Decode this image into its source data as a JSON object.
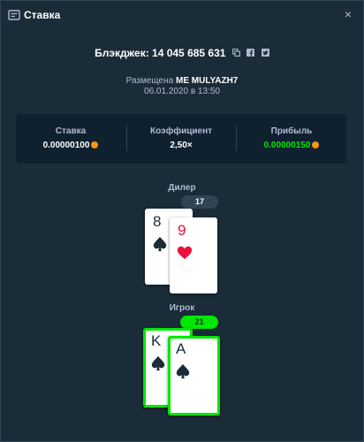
{
  "header": {
    "title": "Ставка",
    "close_glyph": "×"
  },
  "bet": {
    "title": "Блэкджек: 14 045 685 631",
    "placed_prefix": "Размещена",
    "user": "ME MULYAZH7",
    "date": "06.01.2020 в 13:50"
  },
  "stats": {
    "stake_label": "Ставка",
    "stake_value": "0.00000100",
    "multiplier_label": "Коэффициент",
    "multiplier_value": "2,50×",
    "profit_label": "Прибыль",
    "profit_value": "0.00000150"
  },
  "dealer": {
    "label": "Дилер",
    "score": "17",
    "cards": [
      {
        "rank": "8",
        "suit": "spade"
      },
      {
        "rank": "9",
        "suit": "heart"
      }
    ]
  },
  "player": {
    "label": "Игрок",
    "score": "21",
    "cards": [
      {
        "rank": "K",
        "suit": "spade"
      },
      {
        "rank": "A",
        "suit": "spade"
      }
    ]
  },
  "colors": {
    "background": "#1a2c38",
    "panel": "#0f212e",
    "accent_green": "#00e701",
    "coin": "#f7931a",
    "suit_red": "#e9113c",
    "suit_dark": "#1a2c38"
  },
  "icons": {
    "header": "bet-slip-icon",
    "copy": "copy-icon",
    "facebook": "facebook-icon",
    "twitter": "twitter-icon",
    "coin": "bitcoin-icon"
  }
}
